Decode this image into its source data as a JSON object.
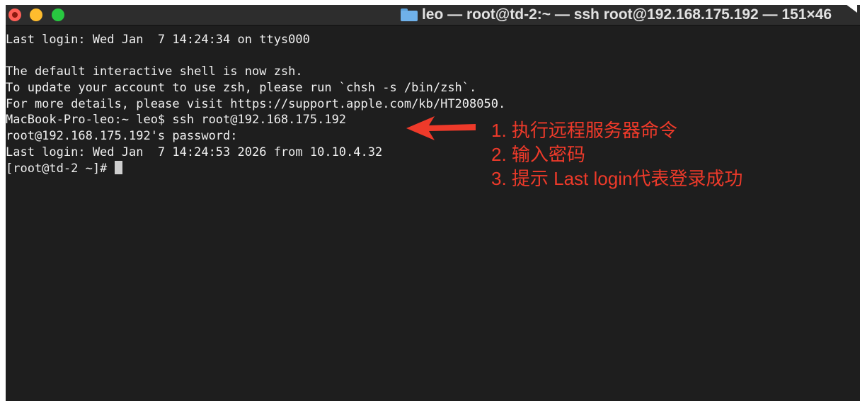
{
  "window": {
    "title": "leo — root@td-2:~ — ssh root@192.168.175.192 — 151×46",
    "title_icon": "folder-icon",
    "controls": [
      "close",
      "minimize",
      "zoom"
    ]
  },
  "terminal": {
    "lines": [
      "Last login: Wed Jan  7 14:24:34 on ttys000",
      "",
      "The default interactive shell is now zsh.",
      "To update your account to use zsh, please run `chsh -s /bin/zsh`.",
      "For more details, please visit https://support.apple.com/kb/HT208050.",
      "MacBook-Pro-leo:~ leo$ ssh root@192.168.175.192",
      "root@192.168.175.192's password:",
      "Last login: Wed Jan  7 14:24:53 2026 from 10.10.4.32",
      "[root@td-2 ~]# "
    ]
  },
  "annotations": {
    "items": [
      "1. 执行远程服务器命令",
      "2. 输入密码",
      "3. 提示 Last login代表登录成功"
    ],
    "color": "#ee3a2a"
  },
  "colors": {
    "terminal_bg": "#1e1e1e",
    "titlebar_bg": "#2d2d2d",
    "text": "#f0f0f0",
    "close": "#fe5f57",
    "minimize": "#febc2e",
    "zoom": "#28c840"
  }
}
